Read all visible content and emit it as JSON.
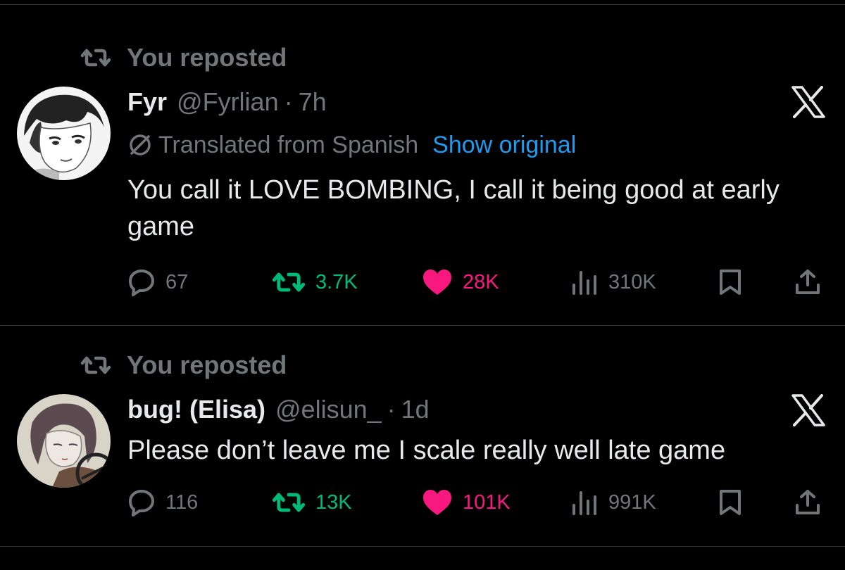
{
  "posts": [
    {
      "repost_label": "You reposted",
      "display_name": "Fyr",
      "handle": "@Fyrlian",
      "separator": "·",
      "time": "7h",
      "translation_note": "Translated from Spanish",
      "show_original": "Show original",
      "text": "You call it LOVE BOMBING, I call it being good at early game",
      "replies": "67",
      "reposts": "3.7K",
      "likes": "28K",
      "views": "310K"
    },
    {
      "repost_label": "You reposted",
      "display_name": "bug! (Elisa)",
      "handle": "@elisun_",
      "separator": "·",
      "time": "1d",
      "text": "Please don’t leave me I scale really well late game",
      "replies": "116",
      "reposts": "13K",
      "likes": "101K",
      "views": "991K"
    }
  ],
  "colors": {
    "background": "#000000",
    "text": "#e7e9ea",
    "muted": "#71767b",
    "link": "#1d9bf0",
    "repost_active": "#00ba7c",
    "like_active": "#f91880",
    "divider": "#2f3336"
  },
  "icons": {
    "repost": "repost-icon",
    "reply": "reply-icon",
    "like": "heart-icon",
    "views": "views-icon",
    "bookmark": "bookmark-icon",
    "share": "share-icon",
    "translate": "translate-icon",
    "brand": "x-logo-icon"
  }
}
